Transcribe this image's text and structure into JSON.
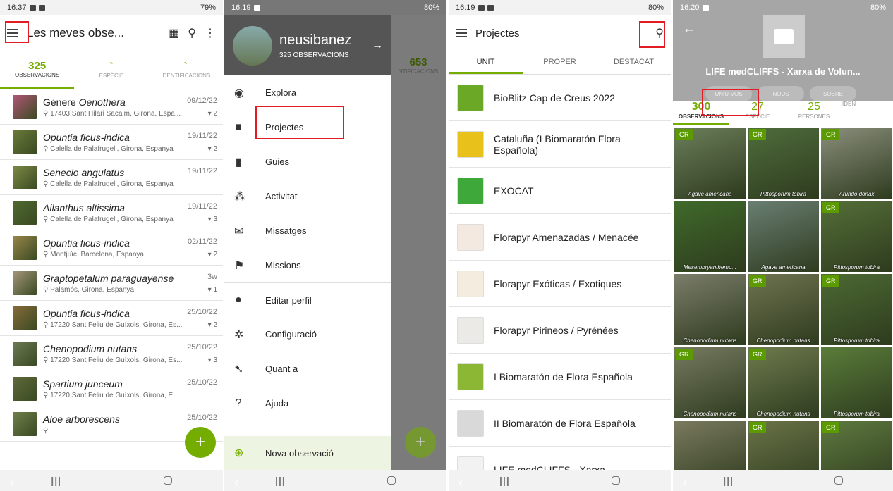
{
  "panel1": {
    "status": {
      "time": "16:37",
      "battery": "79%"
    },
    "title": "Les meves obse...",
    "tabs": [
      {
        "count": "325",
        "label": "OBSERVACIONS"
      },
      {
        "count": "`",
        "label": "ESPÈCIE"
      },
      {
        "count": "`",
        "label": "IDENTIFICACIONS"
      }
    ],
    "observations": [
      {
        "prefix": "Gènere ",
        "name": "Oenothera",
        "date": "09/12/22",
        "place": "17403 Sant Hilari Sacalm, Girona, Espa...",
        "ids": "2",
        "color": "#b25575"
      },
      {
        "prefix": "",
        "name": "Opuntia ficus-indica",
        "date": "19/11/22",
        "place": "Calella de Palafrugell, Girona, Espanya",
        "ids": "2",
        "color": "#6a7a3a"
      },
      {
        "prefix": "",
        "name": "Senecio angulatus",
        "date": "19/11/22",
        "place": "Calella de Palafrugell, Girona, Espanya",
        "ids": "",
        "color": "#7d8a45"
      },
      {
        "prefix": "",
        "name": "Ailanthus altissima",
        "date": "19/11/22",
        "place": "Calella de Palafrugell, Girona, Espanya",
        "ids": "3",
        "color": "#4f6a2f"
      },
      {
        "prefix": "",
        "name": "Opuntia ficus-indica",
        "date": "02/11/22",
        "place": "Montjuïc, Barcelona, Espanya",
        "ids": "2",
        "color": "#98864a"
      },
      {
        "prefix": "",
        "name": "Graptopetalum paraguayense",
        "date": "3w",
        "place": "Palamós, Girona, Espanya",
        "ids": "1",
        "color": "#a49678"
      },
      {
        "prefix": "",
        "name": "Opuntia ficus-indica",
        "date": "25/10/22",
        "place": "17220 Sant Feliu de Guíxols, Girona, Es...",
        "ids": "2",
        "color": "#866a3a"
      },
      {
        "prefix": "",
        "name": "Chenopodium nutans",
        "date": "25/10/22",
        "place": "17220 Sant Feliu de Guíxols, Girona, Es...",
        "ids": "3",
        "color": "#6d7a55"
      },
      {
        "prefix": "",
        "name": "Spartium junceum",
        "date": "25/10/22",
        "place": "17220 Sant Feliu de Guíxols, Girona, E...",
        "ids": "",
        "color": "#5e6a3a"
      },
      {
        "prefix": "",
        "name": "Aloe arborescens",
        "date": "25/10/22",
        "place": "",
        "ids": "",
        "color": "#6f7f4a"
      }
    ],
    "fab": "+"
  },
  "panel2": {
    "status": {
      "time": "16:19",
      "battery": "80%"
    },
    "username": "neusibanez",
    "count": "325 OBSERVACIONS",
    "bg_count": "653",
    "bg_label": "NTIFICACIONS",
    "items": [
      {
        "label": "Explora",
        "icon": "◉"
      },
      {
        "label": "Projectes",
        "icon": "■"
      },
      {
        "label": "Guies",
        "icon": "▮"
      },
      {
        "label": "Activitat",
        "icon": "⁂"
      },
      {
        "label": "Missatges",
        "icon": "✉"
      },
      {
        "label": "Missions",
        "icon": "⚑"
      },
      {
        "label": "Editar perfil",
        "icon": "●"
      },
      {
        "label": "Configuració",
        "icon": "✲"
      },
      {
        "label": "Quant a",
        "icon": "➷"
      },
      {
        "label": "Ajuda",
        "icon": "?"
      }
    ],
    "nova": "Nova observació"
  },
  "panel3": {
    "status": {
      "time": "16:19",
      "battery": "80%"
    },
    "title": "Projectes",
    "tabs": [
      "UNIT",
      "PROPER",
      "DESTACAT"
    ],
    "projects": [
      {
        "name": "BioBlitz Cap de Creus 2022",
        "color": "#6aa825"
      },
      {
        "name": "Cataluña (I Biomaratón Flora Española)",
        "color": "#e8c21a"
      },
      {
        "name": "EXOCAT",
        "color": "#3fa83b"
      },
      {
        "name": "Florapyr Amenazadas / Menacée",
        "color": "#f4e9e0"
      },
      {
        "name": "Florapyr Exóticas / Exotiques",
        "color": "#f3ecdf"
      },
      {
        "name": "Florapyr Pirineos / Pyrénées",
        "color": "#eceae6"
      },
      {
        "name": "I Biomaratón de Flora Española",
        "color": "#8bb734"
      },
      {
        "name": "II Biomaratón de Flora Española",
        "color": "#d9d9d9"
      },
      {
        "name": "LIFE medCLIFFS - Xarxa",
        "color": "#f2f2f2"
      }
    ]
  },
  "panel4": {
    "status": {
      "time": "16:20",
      "battery": "80%"
    },
    "title": "LIFE medCLIFFS - Xarxa de Volun...",
    "buttons": [
      "UNIU-VOS",
      "NOUS",
      "SOBRE"
    ],
    "stats": [
      {
        "count": "300",
        "label": "OBSERVACIONS"
      },
      {
        "count": "27",
        "label": "ESPÈCIE"
      },
      {
        "count": "25",
        "label": "PERSONES"
      },
      {
        "count": "",
        "label": "IDEN"
      }
    ],
    "grade": "GR",
    "photos": [
      {
        "label": "Agave americana",
        "gr": true,
        "color": "#6b7e5a"
      },
      {
        "label": "Pittosporum tobira",
        "gr": true,
        "color": "#4f6d3c"
      },
      {
        "label": "Arundo donax",
        "gr": true,
        "color": "#8b8f7c"
      },
      {
        "label": "Mesembryanthemu...",
        "gr": false,
        "color": "#3f6a2a"
      },
      {
        "label": "Agave americana",
        "gr": false,
        "color": "#6a7f73"
      },
      {
        "label": "Pittosporum tobira",
        "gr": true,
        "color": "#556f38"
      },
      {
        "label": "Chenopodium nutans",
        "gr": false,
        "color": "#7b7d6a"
      },
      {
        "label": "Chenopodium nutans",
        "gr": true,
        "color": "#6f7450"
      },
      {
        "label": "Pittosporum tobira",
        "gr": true,
        "color": "#4c6a33"
      },
      {
        "label": "Chenopodium nutans",
        "gr": true,
        "color": "#767a60"
      },
      {
        "label": "Chenopodium nutans",
        "gr": true,
        "color": "#6e7b4e"
      },
      {
        "label": "Pittosporum tobira",
        "gr": false,
        "color": "#5a7d3a"
      },
      {
        "label": "",
        "gr": false,
        "color": "#7a7a5e"
      },
      {
        "label": "",
        "gr": true,
        "color": "#6b7448"
      },
      {
        "label": "",
        "gr": true,
        "color": "#5f7a40"
      }
    ]
  }
}
